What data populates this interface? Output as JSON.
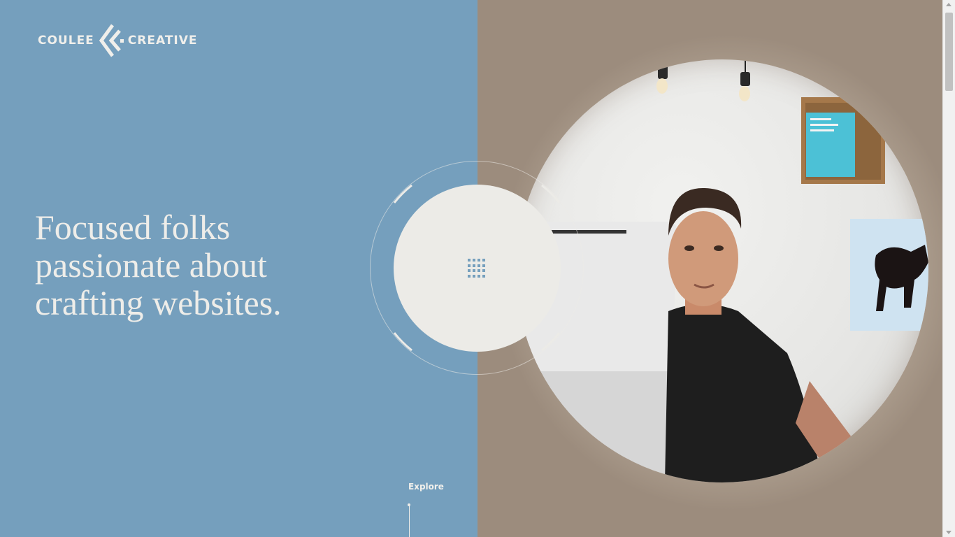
{
  "brand": {
    "name_left": "COULEE",
    "name_right": "CREATIVE"
  },
  "hero": {
    "headline_lines": [
      "Focused folks",
      "passionate about",
      "crafting websites."
    ]
  },
  "nav": {
    "menu_icon": "grid-icon",
    "explore_label": "Explore"
  },
  "colors": {
    "accent_blue": "#759fbd",
    "cream": "#ecebe7"
  }
}
